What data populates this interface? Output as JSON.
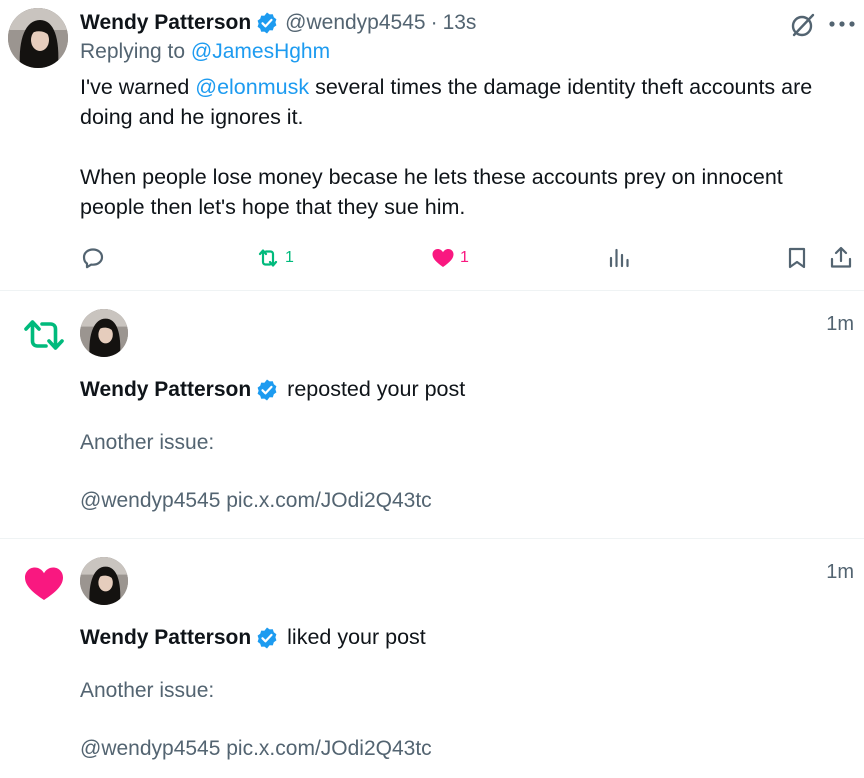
{
  "tweet": {
    "author_name": "Wendy Patterson",
    "handle": "@wendyp4545",
    "separator": "·",
    "time": "13s",
    "replying_prefix": "Replying to",
    "replying_to": "@JamesHghm",
    "text_before_mention": "I've warned ",
    "mention": "@elonmusk",
    "text_after_mention": " several times the damage identity theft accounts are doing and he ignores it.",
    "text_paragraph2": "When people lose money becase he lets these accounts prey on innocent people then let's hope that they sue him.",
    "repost_count": "1",
    "like_count": "1",
    "icons": [
      "reply-icon",
      "repost-icon",
      "like-icon",
      "views-icon",
      "bookmark-icon",
      "share-icon",
      "grok-icon",
      "more-icon",
      "verified-badge-icon"
    ]
  },
  "notifications": [
    {
      "type": "repost",
      "time": "1m",
      "user_name": "Wendy Patterson",
      "action": "reposted your post",
      "preview_line1": "Another issue:",
      "preview_line2": "@wendyp4545 pic.x.com/JOdi2Q43tc"
    },
    {
      "type": "like",
      "time": "1m",
      "user_name": "Wendy Patterson",
      "action": "liked your post",
      "preview_line1": "Another issue:",
      "preview_line2": "@wendyp4545 pic.x.com/JOdi2Q43tc"
    }
  ],
  "colors": {
    "text": "#0f1419",
    "secondary": "#536471",
    "link": "#1d9bf0",
    "repost": "#00ba7c",
    "like": "#f91880",
    "verified": "#1d9bf0"
  }
}
